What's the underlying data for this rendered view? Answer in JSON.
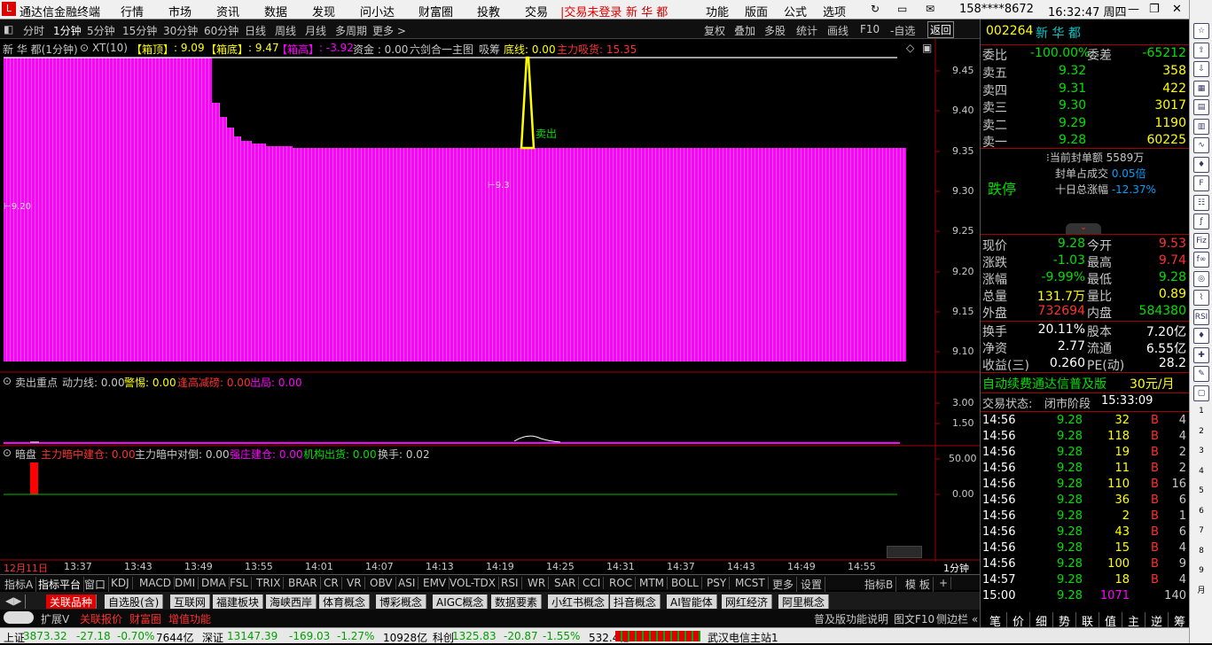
{
  "titlebar": {
    "app": "通达信金融终端",
    "menu": [
      "行情",
      "市场",
      "资讯",
      "数据",
      "发现",
      "问小达",
      "财富圈",
      "投教",
      "交易"
    ],
    "login": "|交易未登录",
    "stock_name": "新 华 都",
    "menu_right": [
      "功能",
      "版面",
      "公式",
      "选项"
    ],
    "user": "158****8672",
    "time": "16:32:47 周四"
  },
  "periods": [
    "分时",
    "1分钟",
    "5分钟",
    "15分钟",
    "30分钟",
    "60分钟",
    "日线",
    "周线",
    "月线",
    "多周期",
    "更多 >"
  ],
  "right_buttons": [
    "复权",
    "叠加",
    "多股",
    "统计",
    "画线",
    "F10",
    "-自选",
    "返回"
  ],
  "main_ind": {
    "name": "新 华 都(1分钟)",
    "formula": "XT(10)",
    "box_top_label": "【箱顶】",
    "box_top": ": 9.09",
    "box_bot_label": "【箱底】",
    "box_bot": ": 9.47",
    "box_high_label": "【箱高】",
    "box_high": ": -3.92",
    "funds": "资金 : 0.00",
    "lhj": "六剑合一主图",
    "xc": "吸筹",
    "dixian": "底线: 0.00",
    "zlxh": "主力吸货: 15.35",
    "sell_label": "卖出",
    "mark1": "9.20",
    "mark2": "9.3"
  },
  "main_axis": [
    "9.45",
    "9.40",
    "9.35",
    "9.30",
    "9.25",
    "9.20",
    "9.15",
    "9.10"
  ],
  "sub1": {
    "name": "卖出重点",
    "dlx": "动力线: 0.00",
    "jj": "警惕: 0.00",
    "fgjc": "逢高减磅: 0.00",
    "cj": "出局: 0.00",
    "axis": [
      "3.00",
      "1.50"
    ]
  },
  "sub2": {
    "name": "暗盘",
    "a": "主力暗中建仓: 0.00",
    "b": "主力暗中对倒: 0.00",
    "c": "强庄建仓: 0.00",
    "d": "机构出货: 0.00",
    "e": "换手: 0.02",
    "axis": [
      "50.00",
      "0.00"
    ]
  },
  "time_axis": [
    "12月11日",
    "13:37",
    "13:43",
    "13:49",
    "13:55",
    "14:01",
    "14:07",
    "14:13",
    "14:19",
    "14:25",
    "14:31",
    "14:37",
    "14:43",
    "14:49",
    "14:55"
  ],
  "period_label": "1分钟",
  "indicator_tabs": [
    "指标A",
    "指标平台",
    "窗口",
    "KDJ",
    "MACD",
    "DMI",
    "DMA",
    "FSL",
    "TRIX",
    "BRAR",
    "CR",
    "VR",
    "OBV",
    "ASI",
    "EMV",
    "VOL-TDX",
    "RSI",
    "WR",
    "SAR",
    "CCI",
    "ROC",
    "MTM",
    "BOLL",
    "PSY",
    "MCST",
    "更多",
    "设置",
    "指标B",
    "模 板",
    "+"
  ],
  "sector_tabs": [
    "关联品种",
    "自选股(含)",
    "互联网",
    "福建板块",
    "海峡西岸",
    "体育概念",
    "博彩概念",
    "AIGC概念",
    "数据要素",
    "小红书概念",
    "抖音概念",
    "AI智能体",
    "网红经济",
    "阿里概念"
  ],
  "bottom3": [
    "扩展V",
    "关联报价",
    "财富圈",
    "增值功能"
  ],
  "bottom3_right": [
    "普及版功能说明",
    "图文F10",
    "侧边栏 «"
  ],
  "right_panel": {
    "code": "002264",
    "name": "新 华 都",
    "weibi_label": "委比",
    "weibi": "-100.00%",
    "weicha_label": "委差",
    "weicha": "-65212",
    "asks": [
      {
        "label": "卖五",
        "price": "9.32",
        "vol": "358"
      },
      {
        "label": "卖四",
        "price": "9.31",
        "vol": "422"
      },
      {
        "label": "卖三",
        "price": "9.30",
        "vol": "3017"
      },
      {
        "label": "卖二",
        "price": "9.29",
        "vol": "1190"
      },
      {
        "label": "卖一",
        "price": "9.28",
        "vol": "60225"
      }
    ],
    "limit_label": "跌停",
    "seal_amount_label": "当前封单额",
    "seal_amount": "5589万",
    "seal_ratio_label": "封单占成交",
    "seal_ratio": "0.05倍",
    "ten_day_label": "十日总涨幅",
    "ten_day": "-12.37%",
    "quotes": [
      {
        "l1": "现价",
        "v1": "9.28",
        "l2": "今开",
        "v2": "9.53"
      },
      {
        "l1": "涨跌",
        "v1": "-1.03",
        "l2": "最高",
        "v2": "9.74"
      },
      {
        "l1": "涨幅",
        "v1": "-9.99%",
        "l2": "最低",
        "v2": "9.28"
      },
      {
        "l1": "总量",
        "v1": "131.7万",
        "l2": "量比",
        "v2": "0.89"
      },
      {
        "l1": "外盘",
        "v1": "732694",
        "l2": "内盘",
        "v2": "584380"
      }
    ],
    "quotes2": [
      {
        "l1": "换手",
        "v1": "20.11%",
        "l2": "股本",
        "v2": "7.20亿"
      },
      {
        "l1": "净资",
        "v1": "2.77",
        "l2": "流通",
        "v2": "6.55亿"
      },
      {
        "l1": "收益(三)",
        "v1": "0.260",
        "l2": "PE(动)",
        "v2": "28.2"
      }
    ],
    "ad": "自动续费通达信普及版",
    "ad_price": "30元/月",
    "trade_state_label": "交易状态:",
    "trade_state": "闭市阶段",
    "trade_time": "15:33:09",
    "ticks": [
      {
        "t": "14:56",
        "p": "9.28",
        "v": "32",
        "s": "B",
        "n": "4"
      },
      {
        "t": "14:56",
        "p": "9.28",
        "v": "118",
        "s": "B",
        "n": "4"
      },
      {
        "t": "14:56",
        "p": "9.28",
        "v": "19",
        "s": "B",
        "n": "2"
      },
      {
        "t": "14:56",
        "p": "9.28",
        "v": "11",
        "s": "B",
        "n": "2"
      },
      {
        "t": "14:56",
        "p": "9.28",
        "v": "110",
        "s": "B",
        "n": "16"
      },
      {
        "t": "14:56",
        "p": "9.28",
        "v": "36",
        "s": "B",
        "n": "6"
      },
      {
        "t": "14:56",
        "p": "9.28",
        "v": "2",
        "s": "B",
        "n": "1"
      },
      {
        "t": "14:56",
        "p": "9.28",
        "v": "43",
        "s": "B",
        "n": "6"
      },
      {
        "t": "14:56",
        "p": "9.28",
        "v": "15",
        "s": "B",
        "n": "4"
      },
      {
        "t": "14:56",
        "p": "9.28",
        "v": "100",
        "s": "B",
        "n": "9"
      },
      {
        "t": "14:57",
        "p": "9.28",
        "v": "18",
        "s": "B",
        "n": "4"
      },
      {
        "t": "15:00",
        "p": "9.28",
        "v": "1071",
        "s": "",
        "n": "140"
      }
    ],
    "bottom_tabs": [
      "笔",
      "价",
      "细",
      "势",
      "联",
      "值",
      "主",
      "逆",
      "筹"
    ]
  },
  "statusbar": {
    "sh_label": "上证",
    "sh": "3873.32",
    "sh_chg": "-27.18",
    "sh_pct": "-0.70%",
    "sh_amt": "7644亿",
    "sz_label": "深证",
    "sz": "13147.39",
    "sz_chg": "-169.03",
    "sz_pct": "-1.27%",
    "sz_amt": "10928亿",
    "kc_label": "科创",
    "kc": "1325.83",
    "kc_chg": "-20.87",
    "kc_pct": "-1.55%",
    "kc_amt": "532.4亿",
    "server": "武汉电信主站1"
  },
  "toolbar_icons": [
    "refresh-icon",
    "minimize-icon",
    "restore-icon",
    "close-icon"
  ],
  "colors": {
    "magenta": "#ff00ff",
    "yellow": "#ffff00",
    "red": "#ff3030",
    "green": "#00e000",
    "cyan": "#00c8c8"
  }
}
